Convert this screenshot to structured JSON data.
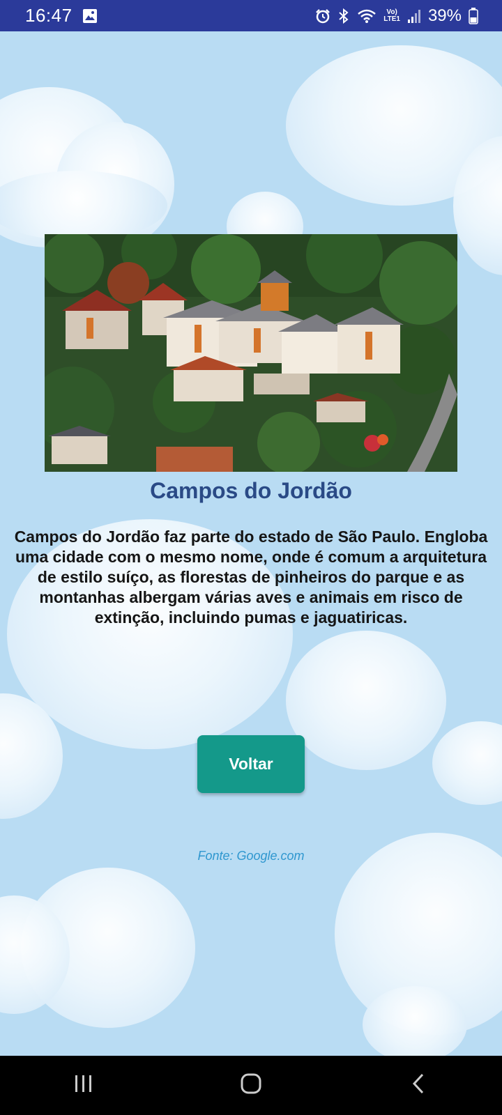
{
  "status_bar": {
    "time": "16:47",
    "battery": "39%",
    "network_label_top": "Vo)",
    "network_label_bottom": "LTE1",
    "icons": [
      "image-icon",
      "alarm-icon",
      "bluetooth-icon",
      "wifi-icon",
      "volte-icon",
      "signal-icon",
      "battery-icon"
    ]
  },
  "main": {
    "image_alt": "Campos do Jordão",
    "title": "Campos do Jordão",
    "description": "Campos do Jordão faz parte do estado de São Paulo. Engloba uma cidade com o mesmo nome, onde é comum a arquitetura de estilo suíço, as florestas de pinheiros do parque e as montanhas albergam várias aves e animais em risco de extinção, incluindo pumas e jaguatiricas.",
    "back_button": "Voltar",
    "source": "Fonte: Google.com"
  },
  "nav_bar": {
    "icons": [
      "recents-icon",
      "home-icon",
      "back-icon"
    ]
  },
  "colors": {
    "status_bar": "#2b3a9a",
    "background": "#b9dcf3",
    "title": "#2a4a86",
    "button": "#14998a",
    "source": "#2f97cf"
  }
}
